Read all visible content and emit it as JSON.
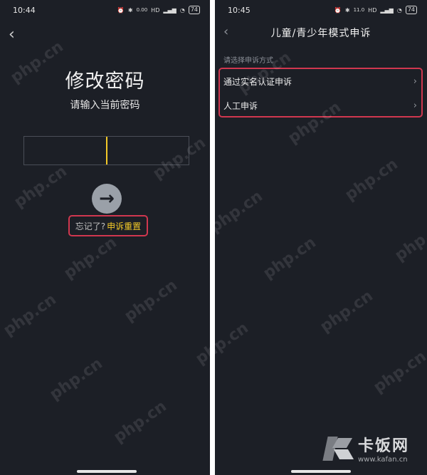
{
  "left_screen": {
    "status": {
      "time": "10:44",
      "net_speed": "0.00",
      "battery": "74"
    },
    "title": "修改密码",
    "subtitle": "请输入当前密码",
    "forgot_text": "忘记了?",
    "appeal_reset": "申诉重置"
  },
  "right_screen": {
    "status": {
      "time": "10:45",
      "net_speed": "11.0",
      "battery": "74"
    },
    "nav_title": "儿童/青少年模式申诉",
    "section_label": "请选择申诉方式",
    "options": [
      {
        "label": "通过实名认证申诉"
      },
      {
        "label": "人工申诉"
      }
    ]
  },
  "watermark": "php.cn",
  "logo": {
    "name": "卡饭网",
    "url": "www.kafan.cn"
  },
  "colors": {
    "background": "#1c1f26",
    "accent": "#f3c928",
    "highlight": "#d0374f"
  }
}
